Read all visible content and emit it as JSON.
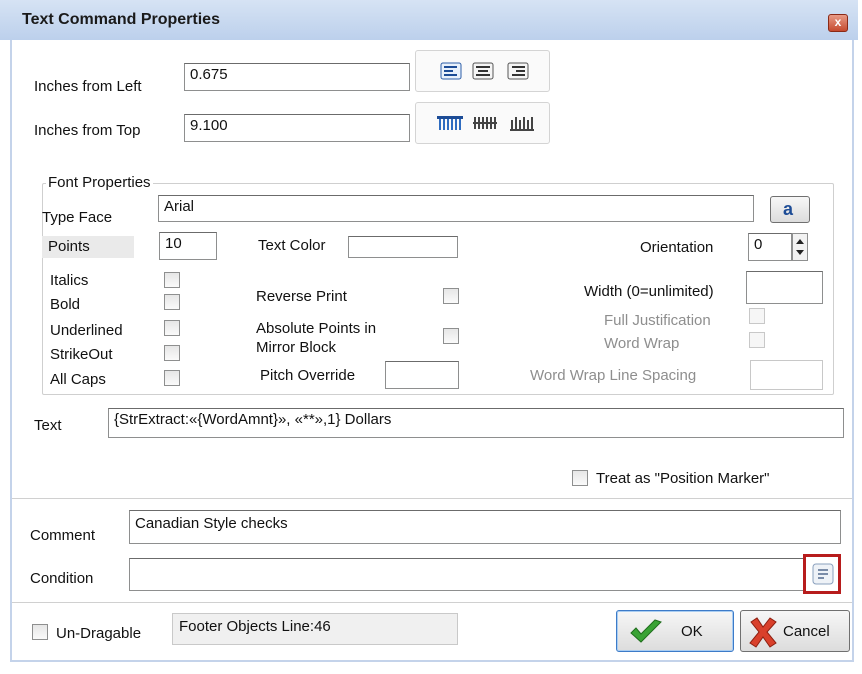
{
  "window": {
    "title": "Text Command Properties",
    "close_glyph": "x"
  },
  "position": {
    "left_label": "Inches from Left",
    "left_value": "0.675",
    "top_label": "Inches from Top",
    "top_value": "9.100"
  },
  "alignment_icons": [
    "align-left-icon",
    "align-center-icon",
    "align-right-icon"
  ],
  "vertical_icons": [
    "valign-top-icon",
    "valign-middle-icon",
    "valign-bottom-icon"
  ],
  "font": {
    "group_label": "Font Properties",
    "typeface_label": "Type Face",
    "typeface_value": "Arial",
    "font_button_label": "a",
    "points_label": "Points",
    "points_value": "10",
    "text_color_label": "Text Color",
    "orientation_label": "Orientation",
    "orientation_value": "0",
    "italics_label": "Italics",
    "bold_label": "Bold",
    "underlined_label": "Underlined",
    "strikeout_label": "StrikeOut",
    "allcaps_label": "All Caps",
    "reverse_print_label": "Reverse Print",
    "absolute_points_label_1": "Absolute Points in",
    "absolute_points_label_2": "Mirror Block",
    "pitch_override_label": "Pitch Override",
    "width_label": "Width (0=unlimited)",
    "full_justification_label": "Full Justification",
    "word_wrap_label": "Word Wrap",
    "word_wrap_spacing_label": "Word Wrap Line Spacing"
  },
  "text": {
    "label": "Text",
    "value": "{StrExtract:«{WordAmnt}», «**»,1} Dollars"
  },
  "position_marker_label": "Treat as \"Position Marker\"",
  "comment": {
    "label": "Comment",
    "value": "Canadian Style checks"
  },
  "condition": {
    "label": "Condition",
    "value": ""
  },
  "footer": {
    "undragable_label": "Un-Dragable",
    "status_text": "Footer Objects  Line:46",
    "ok_label": "OK",
    "cancel_label": "Cancel"
  }
}
